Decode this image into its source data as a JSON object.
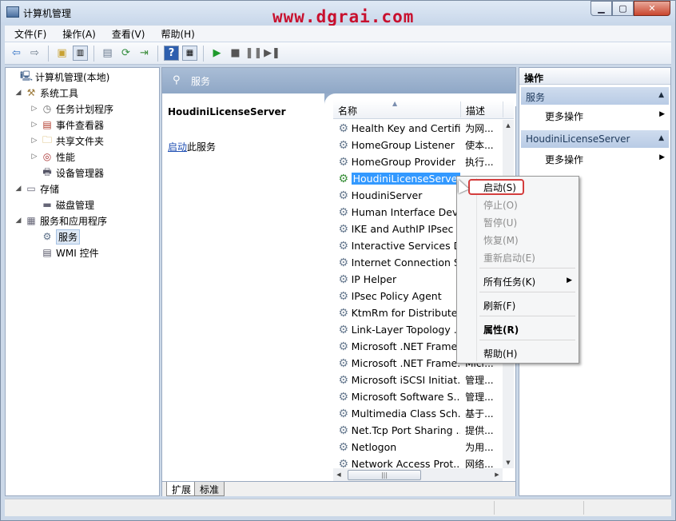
{
  "window": {
    "title": "计算机管理"
  },
  "watermark": "www.dgrai.com",
  "menubar": [
    "文件(F)",
    "操作(A)",
    "查看(V)",
    "帮助(H)"
  ],
  "tree": [
    {
      "label": "计算机管理(本地)",
      "icon": "computer-management-icon",
      "level": 0,
      "expander": ""
    },
    {
      "label": "系统工具",
      "icon": "tools-icon",
      "level": 1,
      "expander": "◢"
    },
    {
      "label": "任务计划程序",
      "icon": "clock-icon",
      "level": 2,
      "expander": "▷"
    },
    {
      "label": "事件查看器",
      "icon": "event-viewer-icon",
      "level": 2,
      "expander": "▷"
    },
    {
      "label": "共享文件夹",
      "icon": "shared-folder-icon",
      "level": 2,
      "expander": "▷"
    },
    {
      "label": "性能",
      "icon": "performance-icon",
      "level": 2,
      "expander": "▷"
    },
    {
      "label": "设备管理器",
      "icon": "device-manager-icon",
      "level": 2,
      "expander": ""
    },
    {
      "label": "存储",
      "icon": "storage-icon",
      "level": 1,
      "expander": "◢"
    },
    {
      "label": "磁盘管理",
      "icon": "disk-icon",
      "level": 2,
      "expander": ""
    },
    {
      "label": "服务和应用程序",
      "icon": "services-apps-icon",
      "level": 1,
      "expander": "◢"
    },
    {
      "label": "服务",
      "icon": "gear-icon",
      "level": 2,
      "expander": "",
      "selected": true
    },
    {
      "label": "WMI 控件",
      "icon": "wmi-icon",
      "level": 2,
      "expander": ""
    }
  ],
  "center": {
    "header_title": "服务",
    "selected_service": "HoudiniLicenseServer",
    "start_link": "启动",
    "start_suffix": "此服务",
    "columns": {
      "name": "名称",
      "description": "描述"
    },
    "services": [
      {
        "name": "Health Key and Certifi...",
        "desc": "为网..."
      },
      {
        "name": "HomeGroup Listener",
        "desc": "使本..."
      },
      {
        "name": "HomeGroup Provider",
        "desc": "执行..."
      },
      {
        "name": "HoudiniLicenseServer",
        "desc": "",
        "highlight": true
      },
      {
        "name": "HoudiniServer",
        "desc": ""
      },
      {
        "name": "Human Interface Devi...",
        "desc": ""
      },
      {
        "name": "IKE and AuthIP IPsec ...",
        "desc": ""
      },
      {
        "name": "Interactive Services D...",
        "desc": ""
      },
      {
        "name": "Internet Connection S...",
        "desc": ""
      },
      {
        "name": "IP Helper",
        "desc": ""
      },
      {
        "name": "IPsec Policy Agent",
        "desc": ""
      },
      {
        "name": "KtmRm for Distribute...",
        "desc": ""
      },
      {
        "name": "Link-Layer Topology ...",
        "desc": ""
      },
      {
        "name": "Microsoft .NET Frame...",
        "desc": ""
      },
      {
        "name": "Microsoft .NET Frame...",
        "desc": "Micr..."
      },
      {
        "name": "Microsoft iSCSI Initiat...",
        "desc": "管理..."
      },
      {
        "name": "Microsoft Software S...",
        "desc": "管理..."
      },
      {
        "name": "Multimedia Class Sch...",
        "desc": "基于..."
      },
      {
        "name": "Net.Tcp Port Sharing ...",
        "desc": "提供..."
      },
      {
        "name": "Netlogon",
        "desc": "为用..."
      },
      {
        "name": "Network Access Prot...",
        "desc": "网络..."
      }
    ],
    "tabs": [
      "扩展",
      "标准"
    ]
  },
  "actions": {
    "title": "操作",
    "sections": [
      {
        "label": "服务",
        "more": "更多操作"
      },
      {
        "label": "HoudiniLicenseServer",
        "more": "更多操作"
      }
    ]
  },
  "context_menu": [
    {
      "label": "启动(S)",
      "state": "enabled",
      "boxed": true
    },
    {
      "label": "停止(O)",
      "state": "disabled"
    },
    {
      "label": "暂停(U)",
      "state": "disabled"
    },
    {
      "label": "恢复(M)",
      "state": "disabled"
    },
    {
      "label": "重新启动(E)",
      "state": "disabled"
    },
    {
      "label": "所有任务(K)",
      "state": "enabled",
      "submenu": true
    },
    {
      "label": "刷新(F)",
      "state": "enabled"
    },
    {
      "label": "属性(R)",
      "state": "enabled",
      "bold": true
    },
    {
      "label": "帮助(H)",
      "state": "enabled"
    }
  ]
}
